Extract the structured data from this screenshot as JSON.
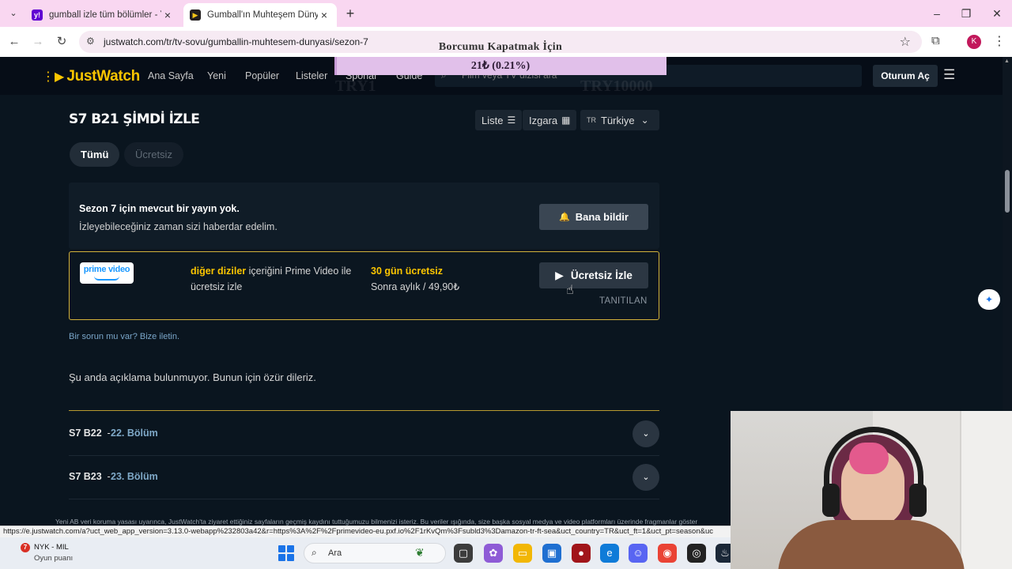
{
  "browser": {
    "tabs": [
      {
        "title": "gumball izle tüm bölümler - Ya",
        "active": false
      },
      {
        "title": "Gumball'ın Muhteşem Dünyası",
        "active": true
      }
    ],
    "url": "justwatch.com/tr/tv-sovu/gumballin-muhtesem-dunyasi/sezon-7",
    "profile_initial": "K",
    "status_url": "https://e.justwatch.com/a?uct_web_app_version=3.13.0-webapp%232803a42&r=https%3A%2F%2Fprimevideo-eu.pxf.io%2F1rKvQm%3Fsubld3%3Damazon-tr-ft-sea&uct_country=TR&uct_ft=1&uct_pt=season&uc"
  },
  "donation": {
    "title": "Borcumu Kapatmak İçin",
    "amount": "21₺ (0.21%)",
    "progress_percent": 0.21,
    "ghost_left": "TRY1",
    "ghost_right": "TRY10000"
  },
  "site": {
    "logo": "JustWatch",
    "nav": [
      "Ana Sayfa",
      "Yeni",
      "Popüler",
      "Listeler",
      "Sporlar",
      "Guide"
    ],
    "search_placeholder": "Film veya TV dizisi ara",
    "login_label": "Oturum Aç"
  },
  "main": {
    "title": "S7 B21 ŞİMDİ İZLE",
    "view_list": "Liste",
    "view_grid": "Izgara",
    "country_code": "TR",
    "country": "Türkiye",
    "filters": [
      "Tümü",
      "Ücretsiz"
    ]
  },
  "notice": {
    "line1": "Sezon 7 için mevcut bir yayın yok.",
    "line2": "İzleyebileceğiniz zaman sizi haberdar edelim.",
    "button": "Bana bildir"
  },
  "offer": {
    "provider_logo": "prime video",
    "highlight": "diğer diziler",
    "description_rest": " içeriğini Prime Video ile ücretsiz izle",
    "trial_title": "30 gün ücretsiz",
    "trial_price": "Sonra aylık / 49,90₺",
    "button": "Ücretsiz İzle",
    "tag": "TANITILAN",
    "border_color": "#d4b23a"
  },
  "issue_link": "Bir sorun mu var? Bize iletin.",
  "no_description": "Şu anda açıklama bulunmuyor. Bunun için özür dileriz.",
  "episodes": [
    {
      "code": "S7 B22",
      "name": "22. Bölüm"
    },
    {
      "code": "S7 B23",
      "name": "23. Bölüm"
    }
  ],
  "cookie_text": "Yeni AB veri koruma yasası uyarınca, JustWatch'ta ziyaret ettiğiniz sayfaların geçmiş kaydını tuttuğumuzu bilmenizi isteriz. Bu veriler ışığında, size başka sosyal medya ve video platformları üzerinde fragmanlar göster",
  "taskbar": {
    "widget_badge": "7",
    "widget_title": "NYK - MIL",
    "widget_subtitle": "Oyun puanı",
    "search_label": "Ara",
    "discord_badge": "9"
  },
  "colors": {
    "accent": "#fbc500",
    "background": "#0a151f",
    "tabstrip": "#f9d7f1"
  }
}
